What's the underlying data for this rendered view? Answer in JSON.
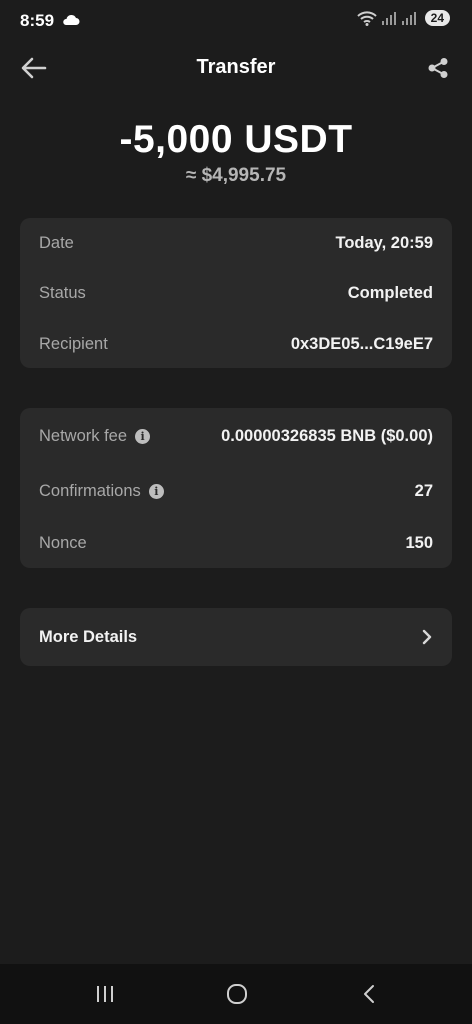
{
  "status_bar": {
    "time": "8:59",
    "battery": "24",
    "icons": [
      "cloud-icon",
      "wifi-icon",
      "signal-icon",
      "signal-icon"
    ]
  },
  "header": {
    "title": "Transfer",
    "back_icon": "arrow-left-icon",
    "share_icon": "share-icon"
  },
  "transaction": {
    "amount": "-5,000 USDT",
    "fiat_value": "≈ $4,995.75"
  },
  "details": [
    {
      "label": "Date",
      "value": "Today, 20:59"
    },
    {
      "label": "Status",
      "value": "Completed"
    },
    {
      "label": "Recipient",
      "value": "0x3DE05...C19eE7"
    }
  ],
  "network": [
    {
      "label": "Network fee",
      "value": "0.00000326835 BNB ($0.00)",
      "info": true
    },
    {
      "label": "Confirmations",
      "value": "27",
      "info": true
    },
    {
      "label": "Nonce",
      "value": "150",
      "info": false
    }
  ],
  "more_details": {
    "label": "More Details",
    "icon": "chevron-right-icon"
  },
  "nav": {
    "icons": [
      "recents-icon",
      "home-icon",
      "back-icon"
    ]
  }
}
